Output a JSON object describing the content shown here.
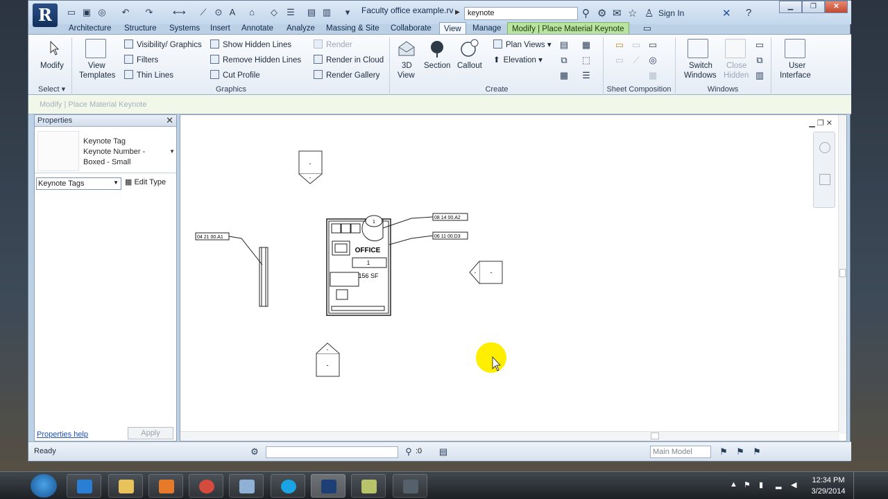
{
  "titlebar": {
    "app_letter": "R",
    "doc_title": "Faculty office example.rv...",
    "search_value": "keynote",
    "sign_in": "Sign In"
  },
  "tabs": [
    {
      "label": "Architecture"
    },
    {
      "label": "Structure"
    },
    {
      "label": "Systems"
    },
    {
      "label": "Insert"
    },
    {
      "label": "Annotate"
    },
    {
      "label": "Analyze"
    },
    {
      "label": "Massing & Site"
    },
    {
      "label": "Collaborate"
    },
    {
      "label": "View"
    },
    {
      "label": "Manage"
    },
    {
      "label": "Modify | Place Material Keynote"
    }
  ],
  "ribbon": {
    "modify": "Modify",
    "view_templates_1": "View",
    "view_templates_2": "Templates",
    "visibility_graphics": "Visibility/ Graphics",
    "filters": "Filters",
    "thin_lines": "Thin Lines",
    "show_hidden_lines": "Show Hidden Lines",
    "remove_hidden_lines": "Remove Hidden Lines",
    "cut_profile": "Cut Profile",
    "render": "Render",
    "render_in_cloud": "Render in Cloud",
    "render_gallery": "Render Gallery",
    "view_3d_1": "3D",
    "view_3d_2": "View",
    "section": "Section",
    "callout": "Callout",
    "plan_views": "Plan Views",
    "elevation": "Elevation",
    "switch_windows_1": "Switch",
    "switch_windows_2": "Windows",
    "close_hidden_1": "Close",
    "close_hidden_2": "Hidden",
    "user_interface_1": "User",
    "user_interface_2": "Interface",
    "panels": {
      "select": "Select",
      "graphics": "Graphics",
      "create": "Create",
      "sheet_composition": "Sheet Composition",
      "windows": "Windows"
    }
  },
  "options_bar": {
    "text": "Modify | Place Material Keynote"
  },
  "properties": {
    "title": "Properties",
    "type_line1": "Keynote Tag",
    "type_line2": "Keynote Number -",
    "type_line3": "Boxed - Small",
    "family_select": "Keynote Tags",
    "edit_type": "Edit Type",
    "help": "Properties help",
    "apply": "Apply"
  },
  "drawing": {
    "keynote_left": "04 21 00.A1",
    "keynote_top_right": "08 14 00.A2",
    "keynote_mid_right": "06 11 00.D3",
    "room_name": "OFFICE",
    "room_number": "1",
    "room_area": "156 SF",
    "door_tag": "1",
    "elev_mark": "-"
  },
  "status": {
    "text": "Ready",
    "zero": ":0",
    "main_model": "Main Model"
  },
  "clock": {
    "time": "12:34 PM",
    "date": "3/29/2014"
  }
}
